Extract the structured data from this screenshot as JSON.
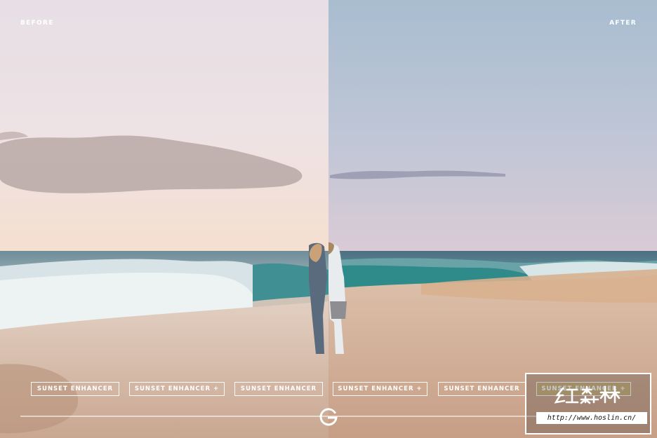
{
  "labels": {
    "before": "BEFORE",
    "after": "AFTER"
  },
  "presets": [
    {
      "label": "SUNSET ENHANCER"
    },
    {
      "label": "SUNSET ENHANCER +"
    },
    {
      "label": "SUNSET ENHANCER"
    },
    {
      "label": "SUNSET ENHANCER +"
    },
    {
      "label": "SUNSET ENHANCER"
    },
    {
      "label": "SUNSET ENHANCER +"
    }
  ],
  "slider": {
    "handle_icon": "g-logo-icon",
    "position_fraction": 0.5
  },
  "watermark": {
    "brand_text": "红森林",
    "url": "http://www.hoslin.cn/"
  },
  "colors": {
    "before_sky_top": "#e9e2e6",
    "before_sky_horizon": "#f4e0d1",
    "after_sky_top": "#a9bfd2",
    "after_sky_horizon": "#d8d0db",
    "sea": "#3f8f93",
    "sand": "#d8bca4",
    "active_preset": "#c8b478"
  }
}
